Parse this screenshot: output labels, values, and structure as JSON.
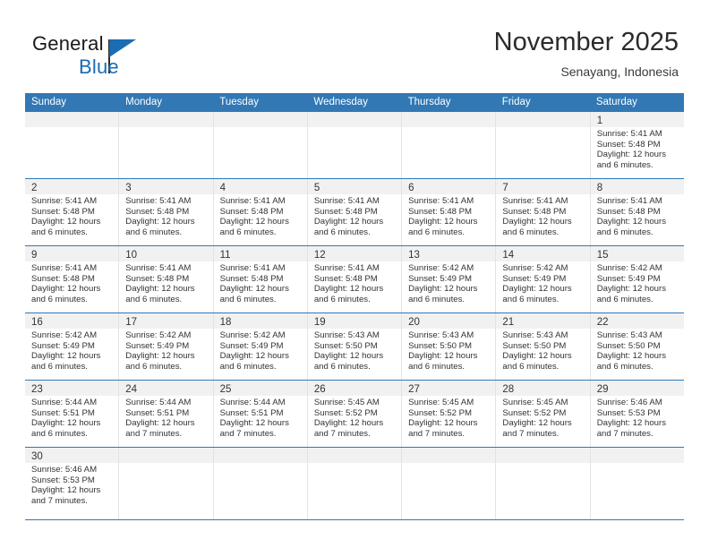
{
  "brand": {
    "name_top": "General",
    "name_bottom": "Blue",
    "accent_color": "#1b6cb3",
    "flag_icon": "flag-triangle-icon"
  },
  "header": {
    "title": "November 2025",
    "subtitle": "Senayang, Indonesia"
  },
  "theme": {
    "header_row_bg": "#3178b4",
    "header_row_text": "#ffffff",
    "daynum_band_bg": "#f1f1f1",
    "cell_bg": "#ffffff",
    "row_separator": "#3178b4",
    "cell_border": "#e3e3e3",
    "text_color": "#333333"
  },
  "labels": {
    "sunrise_prefix": "Sunrise:",
    "sunset_prefix": "Sunset:",
    "daylight_prefix": "Daylight:"
  },
  "weekday_headers": [
    "Sunday",
    "Monday",
    "Tuesday",
    "Wednesday",
    "Thursday",
    "Friday",
    "Saturday"
  ],
  "weeks": [
    [
      {
        "day": "",
        "lines": []
      },
      {
        "day": "",
        "lines": []
      },
      {
        "day": "",
        "lines": []
      },
      {
        "day": "",
        "lines": []
      },
      {
        "day": "",
        "lines": []
      },
      {
        "day": "",
        "lines": []
      },
      {
        "day": "1",
        "lines": [
          "Sunrise: 5:41 AM",
          "Sunset: 5:48 PM",
          "Daylight: 12 hours",
          "and 6 minutes."
        ]
      }
    ],
    [
      {
        "day": "2",
        "lines": [
          "Sunrise: 5:41 AM",
          "Sunset: 5:48 PM",
          "Daylight: 12 hours",
          "and 6 minutes."
        ]
      },
      {
        "day": "3",
        "lines": [
          "Sunrise: 5:41 AM",
          "Sunset: 5:48 PM",
          "Daylight: 12 hours",
          "and 6 minutes."
        ]
      },
      {
        "day": "4",
        "lines": [
          "Sunrise: 5:41 AM",
          "Sunset: 5:48 PM",
          "Daylight: 12 hours",
          "and 6 minutes."
        ]
      },
      {
        "day": "5",
        "lines": [
          "Sunrise: 5:41 AM",
          "Sunset: 5:48 PM",
          "Daylight: 12 hours",
          "and 6 minutes."
        ]
      },
      {
        "day": "6",
        "lines": [
          "Sunrise: 5:41 AM",
          "Sunset: 5:48 PM",
          "Daylight: 12 hours",
          "and 6 minutes."
        ]
      },
      {
        "day": "7",
        "lines": [
          "Sunrise: 5:41 AM",
          "Sunset: 5:48 PM",
          "Daylight: 12 hours",
          "and 6 minutes."
        ]
      },
      {
        "day": "8",
        "lines": [
          "Sunrise: 5:41 AM",
          "Sunset: 5:48 PM",
          "Daylight: 12 hours",
          "and 6 minutes."
        ]
      }
    ],
    [
      {
        "day": "9",
        "lines": [
          "Sunrise: 5:41 AM",
          "Sunset: 5:48 PM",
          "Daylight: 12 hours",
          "and 6 minutes."
        ]
      },
      {
        "day": "10",
        "lines": [
          "Sunrise: 5:41 AM",
          "Sunset: 5:48 PM",
          "Daylight: 12 hours",
          "and 6 minutes."
        ]
      },
      {
        "day": "11",
        "lines": [
          "Sunrise: 5:41 AM",
          "Sunset: 5:48 PM",
          "Daylight: 12 hours",
          "and 6 minutes."
        ]
      },
      {
        "day": "12",
        "lines": [
          "Sunrise: 5:41 AM",
          "Sunset: 5:48 PM",
          "Daylight: 12 hours",
          "and 6 minutes."
        ]
      },
      {
        "day": "13",
        "lines": [
          "Sunrise: 5:42 AM",
          "Sunset: 5:49 PM",
          "Daylight: 12 hours",
          "and 6 minutes."
        ]
      },
      {
        "day": "14",
        "lines": [
          "Sunrise: 5:42 AM",
          "Sunset: 5:49 PM",
          "Daylight: 12 hours",
          "and 6 minutes."
        ]
      },
      {
        "day": "15",
        "lines": [
          "Sunrise: 5:42 AM",
          "Sunset: 5:49 PM",
          "Daylight: 12 hours",
          "and 6 minutes."
        ]
      }
    ],
    [
      {
        "day": "16",
        "lines": [
          "Sunrise: 5:42 AM",
          "Sunset: 5:49 PM",
          "Daylight: 12 hours",
          "and 6 minutes."
        ]
      },
      {
        "day": "17",
        "lines": [
          "Sunrise: 5:42 AM",
          "Sunset: 5:49 PM",
          "Daylight: 12 hours",
          "and 6 minutes."
        ]
      },
      {
        "day": "18",
        "lines": [
          "Sunrise: 5:42 AM",
          "Sunset: 5:49 PM",
          "Daylight: 12 hours",
          "and 6 minutes."
        ]
      },
      {
        "day": "19",
        "lines": [
          "Sunrise: 5:43 AM",
          "Sunset: 5:50 PM",
          "Daylight: 12 hours",
          "and 6 minutes."
        ]
      },
      {
        "day": "20",
        "lines": [
          "Sunrise: 5:43 AM",
          "Sunset: 5:50 PM",
          "Daylight: 12 hours",
          "and 6 minutes."
        ]
      },
      {
        "day": "21",
        "lines": [
          "Sunrise: 5:43 AM",
          "Sunset: 5:50 PM",
          "Daylight: 12 hours",
          "and 6 minutes."
        ]
      },
      {
        "day": "22",
        "lines": [
          "Sunrise: 5:43 AM",
          "Sunset: 5:50 PM",
          "Daylight: 12 hours",
          "and 6 minutes."
        ]
      }
    ],
    [
      {
        "day": "23",
        "lines": [
          "Sunrise: 5:44 AM",
          "Sunset: 5:51 PM",
          "Daylight: 12 hours",
          "and 6 minutes."
        ]
      },
      {
        "day": "24",
        "lines": [
          "Sunrise: 5:44 AM",
          "Sunset: 5:51 PM",
          "Daylight: 12 hours",
          "and 7 minutes."
        ]
      },
      {
        "day": "25",
        "lines": [
          "Sunrise: 5:44 AM",
          "Sunset: 5:51 PM",
          "Daylight: 12 hours",
          "and 7 minutes."
        ]
      },
      {
        "day": "26",
        "lines": [
          "Sunrise: 5:45 AM",
          "Sunset: 5:52 PM",
          "Daylight: 12 hours",
          "and 7 minutes."
        ]
      },
      {
        "day": "27",
        "lines": [
          "Sunrise: 5:45 AM",
          "Sunset: 5:52 PM",
          "Daylight: 12 hours",
          "and 7 minutes."
        ]
      },
      {
        "day": "28",
        "lines": [
          "Sunrise: 5:45 AM",
          "Sunset: 5:52 PM",
          "Daylight: 12 hours",
          "and 7 minutes."
        ]
      },
      {
        "day": "29",
        "lines": [
          "Sunrise: 5:46 AM",
          "Sunset: 5:53 PM",
          "Daylight: 12 hours",
          "and 7 minutes."
        ]
      }
    ],
    [
      {
        "day": "30",
        "lines": [
          "Sunrise: 5:46 AM",
          "Sunset: 5:53 PM",
          "Daylight: 12 hours",
          "and 7 minutes."
        ]
      },
      {
        "day": "",
        "lines": []
      },
      {
        "day": "",
        "lines": []
      },
      {
        "day": "",
        "lines": []
      },
      {
        "day": "",
        "lines": []
      },
      {
        "day": "",
        "lines": []
      },
      {
        "day": "",
        "lines": []
      }
    ]
  ]
}
